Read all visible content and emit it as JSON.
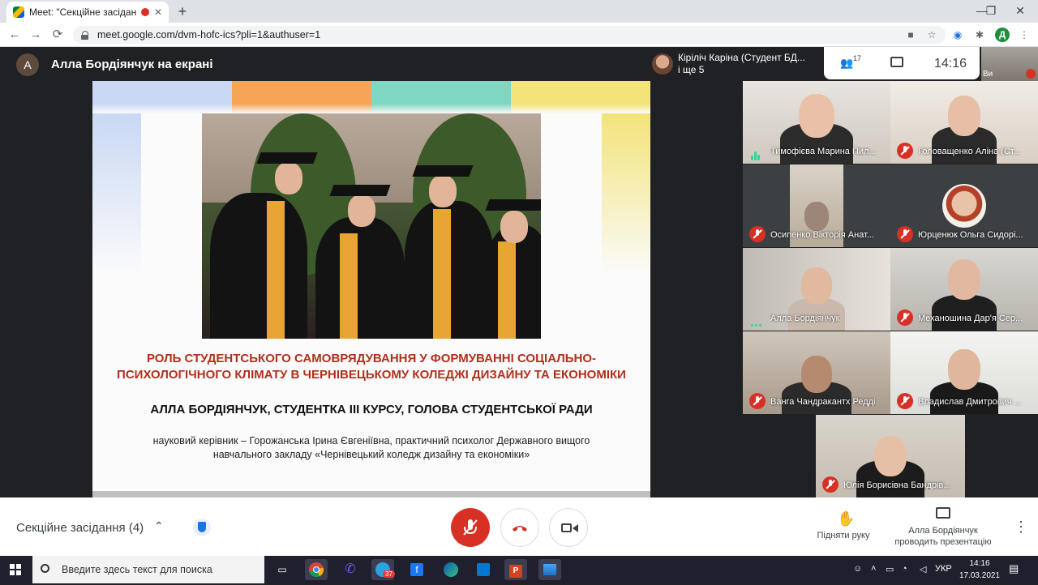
{
  "browser": {
    "tab_title": "Meet: \"Секційне засідання (",
    "new_tab": "+",
    "url": "meet.google.com/dvm-hofc-ics?pli=1&authuser=1",
    "profile_initial": "Д",
    "window_controls": [
      "—",
      "❐",
      "✕"
    ],
    "nav": [
      "←",
      "→",
      "⟳"
    ]
  },
  "meet_header": {
    "presenter_initial": "А",
    "presenter_title": "Алла Бордіянчук на екрані",
    "speaker_name": "Кіріліч Каріна (Студент БД...",
    "speaker_more": "і ще 5",
    "people_count": "17",
    "time": "14:16",
    "self_label": "Ви"
  },
  "slide": {
    "title_line1": "РОЛЬ СТУДЕНТСЬКОГО САМОВРЯДУВАННЯ У ФОРМУВАННІ СОЦІАЛЬНО-",
    "title_line2": "ПСИХОЛОГІЧНОГО КЛІМАТУ В ЧЕРНІВЕЦЬКОМУ КОЛЕДЖІ ДИЗАЙНУ ТА ЕКОНОМІКИ",
    "author": "АЛЛА БОРДІЯНЧУК, СТУДЕНТКА ІІІ КУРСУ, ГОЛОВА СТУДЕНТСЬКОЇ РАДИ",
    "advisor_line1": "науковий керівник – Горожанська Ірина Євгеніївна, практичний психолог Державного вищого",
    "advisor_line2": "навчального закладу «Чернівецький коледж дизайну та економіки»",
    "stripe_colors": [
      "#c9d8f4",
      "#f6a557",
      "#7fd6c2",
      "#f3e37a"
    ]
  },
  "participants": [
    {
      "name": "Тимофієва Марина Пил...",
      "state": "speaking"
    },
    {
      "name": "Головащенко Аліна (Ст...",
      "state": "muted"
    },
    {
      "name": "Осипенко Вікторія Анат...",
      "state": "muted"
    },
    {
      "name": "Юрценюк Ольга Сидорі...",
      "state": "muted"
    },
    {
      "name": "Алла Бордіянчук",
      "state": "presenting"
    },
    {
      "name": "Механошина Дар'я Сер...",
      "state": "muted"
    },
    {
      "name": "Ванга Чандракантх Редді",
      "state": "muted"
    },
    {
      "name": "Владислав Дмитрович ...",
      "state": "muted"
    },
    {
      "name": "Юлія Борисівна Бандрів...",
      "state": "muted"
    }
  ],
  "controls": {
    "meeting_name": "Секційне засідання (4)",
    "raise_hand": "Підняти руку",
    "presenting_line1": "Алла Бордіянчук",
    "presenting_line2": "проводить презентацію"
  },
  "taskbar": {
    "search_placeholder": "Введите здесь текст для поиска",
    "badge": "37",
    "lang": "УКР",
    "time": "14:16",
    "date": "17.03.2021"
  },
  "colors": {
    "meet_dark": "#202124",
    "mic_off_red": "#d93025",
    "slide_title": "#b0301c"
  }
}
